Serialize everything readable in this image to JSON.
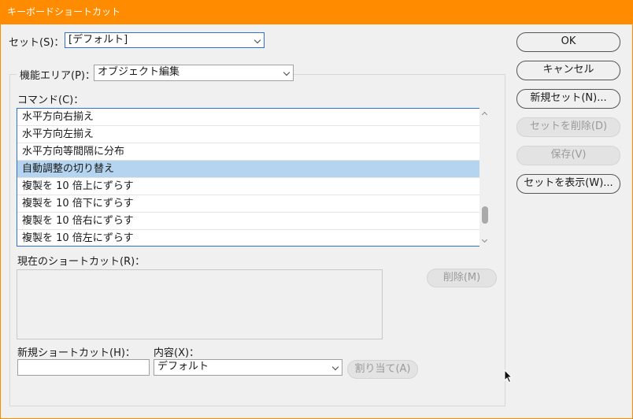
{
  "window": {
    "title": "キーボードショートカット"
  },
  "set": {
    "label": "セット(S)：",
    "value": "[デフォルト]"
  },
  "area": {
    "label": "機能エリア(P)：",
    "value": "オブジェクト編集"
  },
  "commands": {
    "label": "コマンド(C)：",
    "items": [
      "水平方向右揃え",
      "水平方向左揃え",
      "水平方向等間隔に分布",
      "自動調整の切り替え",
      "複製を 10 倍上にずらす",
      "複製を 10 倍下にずらす",
      "複製を 10 倍右にずらす",
      "複製を 10 倍左にずらす"
    ],
    "selected_index": 3
  },
  "current_shortcut": {
    "label": "現在のショートカット(R)：",
    "remove_button": "削除(M)"
  },
  "new_shortcut": {
    "label": "新規ショートカット(H)：",
    "value": ""
  },
  "context": {
    "label": "内容(X)：",
    "value": "デフォルト"
  },
  "assign_button": "割り当て(A)",
  "buttons": {
    "ok": "OK",
    "cancel": "キャンセル",
    "new_set": "新規セット(N)...",
    "delete_set": "セットを削除(D)",
    "save": "保存(V)",
    "show_set": "セットを表示(W)..."
  },
  "colors": {
    "titlebar": "#ff8c00",
    "selection": "#b4d4f0",
    "focus_border": "#2f6fd1"
  }
}
